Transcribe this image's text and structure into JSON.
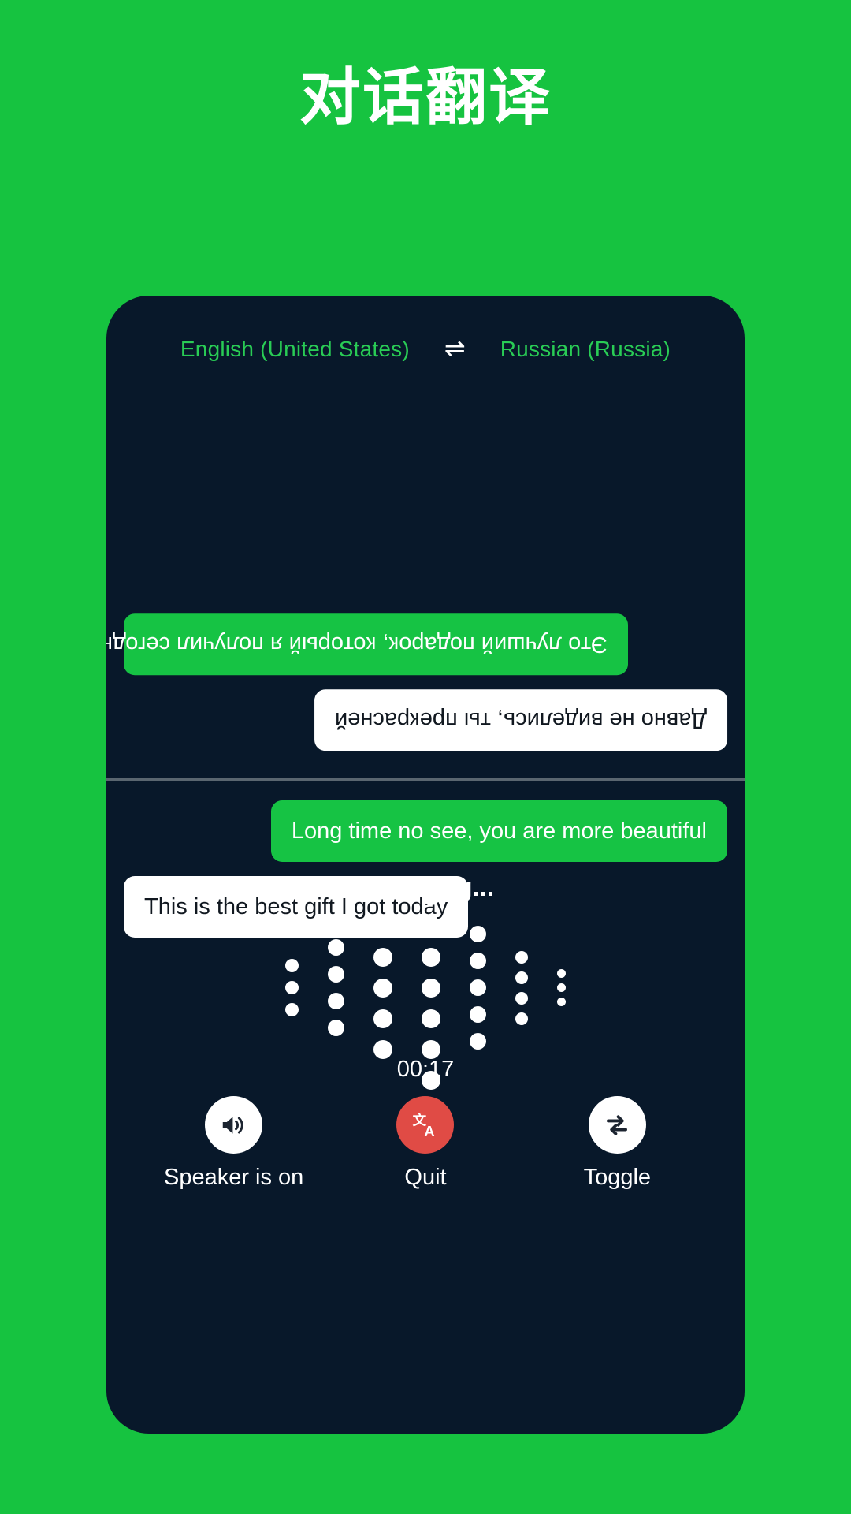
{
  "page": {
    "title": "对话翻译",
    "background_color": "#16C340",
    "phone_color": "#08182A"
  },
  "language_bar": {
    "source_language": "English (United States)",
    "swap_icon": "swap-horizontal-icon",
    "swap_glyph": "⇌",
    "target_language": "Russian (Russia)",
    "text_color": "#29CC55"
  },
  "conversation": {
    "top_pane": {
      "rotated": true,
      "messages": [
        {
          "text": "Это лучший подарок, который я получил сегодня",
          "style": "green",
          "align": "left"
        },
        {
          "text": "Давно не виделись, ты прекрасней",
          "style": "white",
          "align": "right"
        }
      ]
    },
    "bottom_pane": {
      "rotated": false,
      "messages": [
        {
          "text": "Long time no see, you are more beautiful",
          "style": "green",
          "align": "right"
        },
        {
          "text": "This is the best gift I got today",
          "style": "white",
          "align": "left"
        }
      ]
    }
  },
  "status": {
    "listening_label": "Listening...",
    "timer": "00:17"
  },
  "waveform": {
    "columns": [
      {
        "dots": 3,
        "size": 17
      },
      {
        "dots": 4,
        "size": 21
      },
      {
        "dots": 5,
        "size": 24
      },
      {
        "dots": 7,
        "size": 24
      },
      {
        "dots": 5,
        "size": 21
      },
      {
        "dots": 4,
        "size": 16
      },
      {
        "dots": 3,
        "size": 11
      }
    ],
    "color": "#ffffff"
  },
  "controls": [
    {
      "id": "speaker",
      "label": "Speaker is on",
      "icon": "speaker-on-icon",
      "circle_color": "#ffffff",
      "icon_color": "#1c2430"
    },
    {
      "id": "quit",
      "label": "Quit",
      "icon": "translate-icon",
      "circle_color": "#E04B45",
      "icon_color": "#ffffff"
    },
    {
      "id": "toggle",
      "label": "Toggle",
      "icon": "swap-arrows-icon",
      "circle_color": "#ffffff",
      "icon_color": "#1c2430"
    }
  ]
}
